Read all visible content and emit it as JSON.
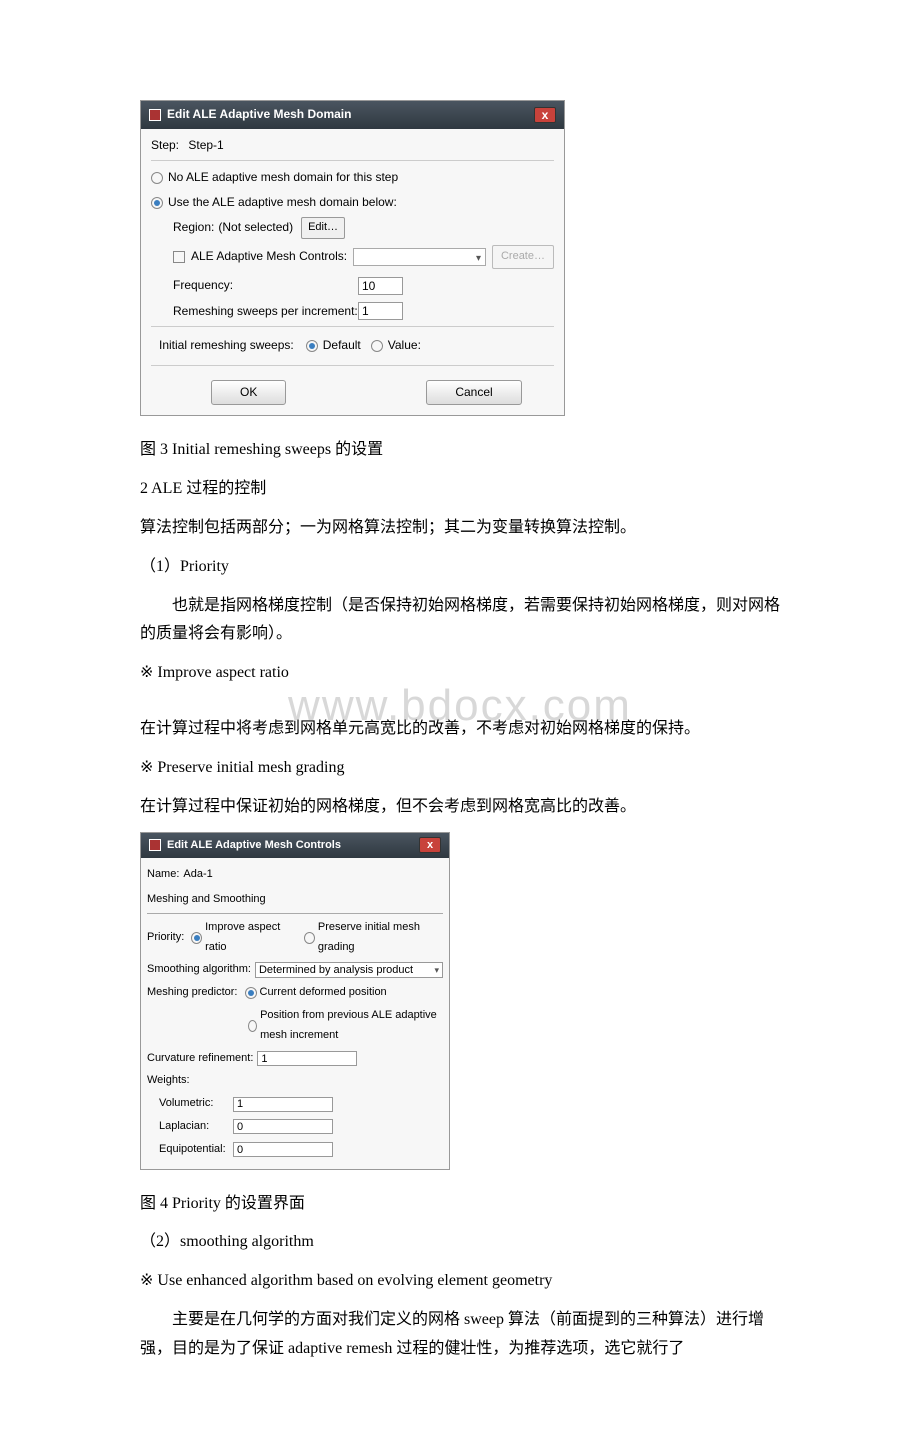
{
  "dialog1": {
    "title": "Edit ALE Adaptive Mesh Domain",
    "step_label": "Step:",
    "step_value": "Step-1",
    "opt_none": "No ALE adaptive mesh domain for this step",
    "opt_use": "Use the ALE adaptive mesh domain below:",
    "region_label": "Region:",
    "region_value": "(Not selected)",
    "edit_btn": "Edit…",
    "controls_label": "ALE Adaptive Mesh Controls:",
    "create_btn": "Create…",
    "freq_label": "Frequency:",
    "freq_value": "10",
    "sweeps_label": "Remeshing sweeps per increment:",
    "sweeps_value": "1",
    "init_label": "Initial remeshing sweeps:",
    "init_default": "Default",
    "init_value": "Value:",
    "ok": "OK",
    "cancel": "Cancel"
  },
  "text": {
    "fig3": "图 3 Initial remeshing sweeps 的设置",
    "h2": "2 ALE 过程的控制",
    "p1": "算法控制包括两部分；一为网格算法控制；其二为变量转换算法控制。",
    "sub1": "（1）Priority",
    "p2": "也就是指网格梯度控制（是否保持初始网格梯度，若需要保持初始网格梯度，则对网格的质量将会有影响）。",
    "b1": "※ Improve aspect ratio",
    "wm": "www.bdocx.com",
    "p3": "在计算过程中将考虑到网格单元高宽比的改善，不考虑对初始网格梯度的保持。",
    "b2": "※ Preserve initial mesh grading",
    "p4": "在计算过程中保证初始的网格梯度，但不会考虑到网格宽高比的改善。",
    "fig4": "图 4 Priority 的设置界面",
    "sub2": "（2）smoothing algorithm",
    "b3": "※ Use enhanced algorithm based on evolving element geometry",
    "p5": "主要是在几何学的方面对我们定义的网格 sweep 算法（前面提到的三种算法）进行增强，目的是为了保证 adaptive remesh 过程的健壮性，为推荐选项，选它就行了"
  },
  "dialog2": {
    "title": "Edit ALE Adaptive Mesh Controls",
    "name_label": "Name:",
    "name_value": "Ada-1",
    "tab": "Meshing and Smoothing",
    "priority_label": "Priority:",
    "priority_opt1": "Improve aspect ratio",
    "priority_opt2": "Preserve initial mesh grading",
    "smoothing_label": "Smoothing algorithm:",
    "smoothing_value": "Determined by analysis product",
    "meshpred_label": "Meshing predictor:",
    "meshpred_opt1": "Current deformed position",
    "meshpred_opt2": "Position from previous ALE adaptive mesh increment",
    "curv_label": "Curvature refinement:",
    "curv_value": "1",
    "weights_label": "Weights:",
    "w_vol_label": "Volumetric:",
    "w_vol_value": "1",
    "w_lap_label": "Laplacian:",
    "w_lap_value": "0",
    "w_eq_label": "Equipotential:",
    "w_eq_value": "0"
  }
}
